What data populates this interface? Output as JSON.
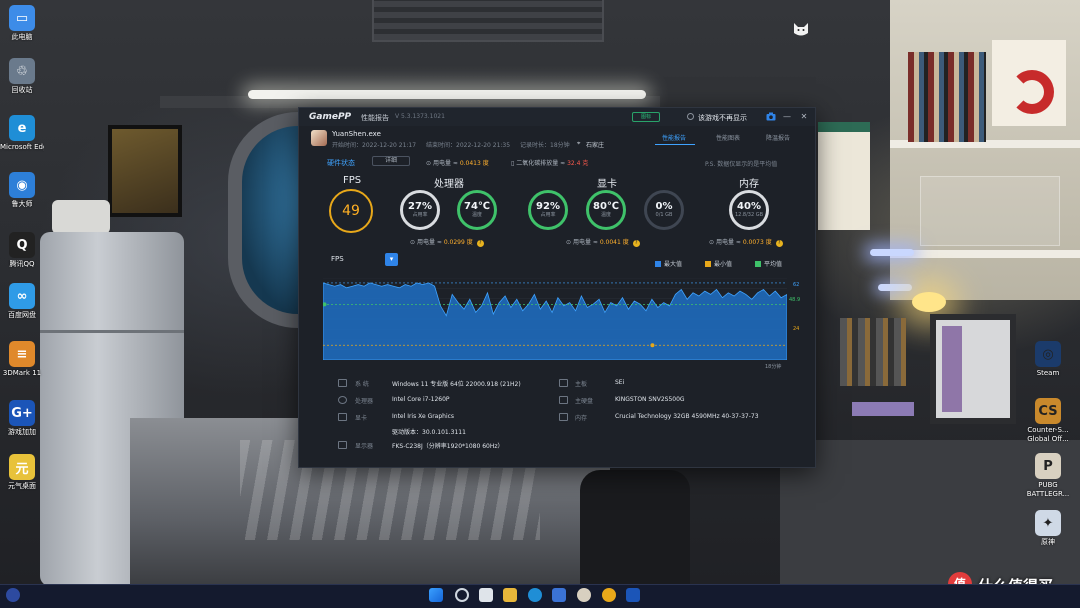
{
  "desktop": {
    "icons_left": [
      {
        "label": "此电脑",
        "glyph": "▭",
        "color": "#3d8ce8"
      },
      {
        "label": "回收站",
        "glyph": "♲",
        "color": "#6a7a8c"
      },
      {
        "label": "Microsoft Edge",
        "glyph": "e",
        "color": "#1f8ed6"
      },
      {
        "label": "鲁大师",
        "glyph": "◉",
        "color": "#2d7fd8"
      },
      {
        "label": "腾讯QQ",
        "glyph": "Q",
        "color": "#222"
      },
      {
        "label": "百度网盘",
        "glyph": "∞",
        "color": "#2f9be7"
      },
      {
        "label": "3DMark 11",
        "glyph": "≡",
        "color": "#e0892b"
      },
      {
        "label": "游戏加加",
        "glyph": "G+",
        "color": "#1b55b8"
      },
      {
        "label": "元气桌面",
        "glyph": "元",
        "color": "#e8c23a"
      }
    ],
    "icons_right": [
      {
        "label": "Steam",
        "glyph": "◎",
        "color": "#1b3b6b"
      },
      {
        "label": "Counter-S... Global Off...",
        "glyph": "CS",
        "color": "#c9892c"
      },
      {
        "label": "PUBG BATTLEGR...",
        "glyph": "P",
        "color": "#d8d0c0"
      },
      {
        "label": "原神",
        "glyph": "✦",
        "color": "#cfd9e6"
      }
    ],
    "watermark": "什么值得买",
    "watermark_logo": "值"
  },
  "gamepp": {
    "logo": "GamePP",
    "title": "性能报告",
    "version": "V 5.3.1373.1021",
    "pill": "图标",
    "checkbox_label": "该游戏不再显示",
    "process": "YuanShen.exe",
    "start_time": "开始时间：2022-12-20 21:17",
    "end_time": "结束时间：2022-12-20 21:35",
    "record_time": "记录时长：18分钟",
    "location": "石家庄",
    "tabs": [
      "性能报告",
      "性能图表",
      "降温报告"
    ],
    "hw_status_label": "硬件状态",
    "hw_status_btn": "详细",
    "power_total_prefix": "用电量 ≈",
    "power_total": "0.0413 度",
    "co2_prefix": "二氧化碳排放量 ≈",
    "co2": "32.4 克",
    "note": "P.S. 数据仅显示的是平均值",
    "sections": {
      "fps": "FPS",
      "cpu": "处理器",
      "gpu": "显卡",
      "mem": "内存"
    },
    "fps_value": "49",
    "rings": {
      "cpu_usage": {
        "value": "27%",
        "sub": "占用率"
      },
      "cpu_temp": {
        "value": "74℃",
        "sub": "温度"
      },
      "gpu_usage": {
        "value": "92%",
        "sub": "占用率"
      },
      "gpu_temp": {
        "value": "80℃",
        "sub": "温度"
      },
      "gpu_mem": {
        "value": "0%",
        "sub": "0/1 GB"
      },
      "mem_usage": {
        "value": "40%",
        "sub": "12.8/32 GB"
      }
    },
    "ring_colors": {
      "cpu_usage": "#d9dce0",
      "cpu_temp": "#3fc26a",
      "gpu_usage": "#3fc26a",
      "gpu_temp": "#3fc26a",
      "gpu_mem": "#3f4652",
      "mem_usage": "#d9dce0"
    },
    "cpu_power": {
      "prefix": "用电量 ≈",
      "value": "0.0299 度"
    },
    "gpu_power": {
      "prefix": "用电量 ≈",
      "value": "0.0041 度"
    },
    "mem_power": {
      "prefix": "用电量 ≈",
      "value": "0.0073 度"
    },
    "chart_select": "FPS",
    "legend": [
      {
        "label": "最大值",
        "color": "#2f84e8"
      },
      {
        "label": "最小值",
        "color": "#e8a81a"
      },
      {
        "label": "平均值",
        "color": "#3fc26a"
      }
    ],
    "duration_label": "18分钟",
    "specs": [
      {
        "key": "系 统",
        "value": "Windows 11 专业版 64位 22000.918 (21H2)"
      },
      {
        "key": "主板",
        "value": "SEi"
      },
      {
        "key": "处理器",
        "value": "Intel Core i7-1260P"
      },
      {
        "key": "主硬盘",
        "value": "KINGSTON SNV2S500G"
      },
      {
        "key": "显卡",
        "value": "Intel Iris Xe Graphics"
      },
      {
        "key": "内存",
        "value": "Crucial Technology 32GB 4590MHz 40-37-37-73"
      },
      {
        "key": "",
        "value": "驱动版本：30.0.101.3111"
      },
      {
        "key": "显示器",
        "value": "FKS-C238J（分辨率1920*1080 60Hz）"
      }
    ]
  },
  "chart_data": {
    "type": "area",
    "title": "",
    "xlabel": "",
    "ylabel": "",
    "series": [
      {
        "name": "FPS",
        "values": [
          62,
          61,
          60,
          61,
          59,
          60,
          61,
          60,
          62,
          61,
          60,
          61,
          60,
          59,
          61,
          60,
          62,
          61,
          62,
          60,
          48,
          42,
          55,
          50,
          46,
          52,
          44,
          48,
          56,
          43,
          50,
          54,
          47,
          52,
          45,
          49,
          55,
          46,
          51,
          44,
          53,
          48,
          50,
          45,
          54,
          47,
          49,
          52,
          44,
          50,
          48,
          53,
          46,
          51,
          49,
          45,
          52,
          47,
          50,
          48,
          55,
          58,
          52,
          56,
          54,
          57,
          55,
          58,
          53,
          56,
          54,
          57,
          55,
          52,
          56,
          58,
          54,
          57,
          53,
          55
        ]
      }
    ],
    "max": 62,
    "avg": 48.9,
    "min": 24,
    "ylim": [
      15,
      65
    ],
    "grid": true,
    "legend_position": "top-right"
  }
}
